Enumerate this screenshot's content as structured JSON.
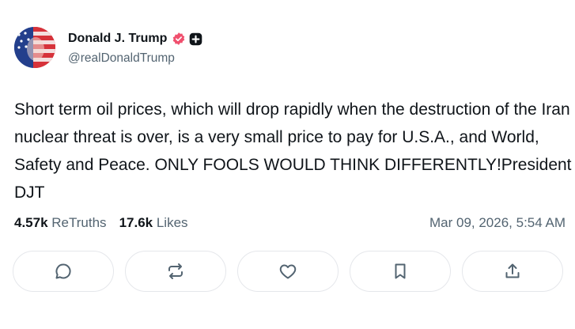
{
  "author": {
    "display_name": "Donald J. Trump",
    "handle": "@realDonaldTrump",
    "avatar_icon": "flag-portrait-avatar",
    "verified_icon": "verified-badge-icon",
    "verified_color": "#f0506e",
    "plus_icon": "plus-badge-icon"
  },
  "post": {
    "text": "Short term oil prices, which will drop rapidly when the destruction of the Iran nuclear threat is over, is a very small price to pay for U.S.A., and World, Safety and Peace. ONLY FOOLS WOULD THINK DIFFERENTLY!President DJT"
  },
  "stats": {
    "retruths_count": "4.57k",
    "retruths_label": "ReTruths",
    "likes_count": "17.6k",
    "likes_label": "Likes",
    "timestamp": "Mar 09, 2026, 5:54 AM"
  },
  "actions": [
    {
      "icon": "reply-icon"
    },
    {
      "icon": "retruth-icon"
    },
    {
      "icon": "like-icon"
    },
    {
      "icon": "bookmark-icon"
    },
    {
      "icon": "share-icon"
    }
  ]
}
